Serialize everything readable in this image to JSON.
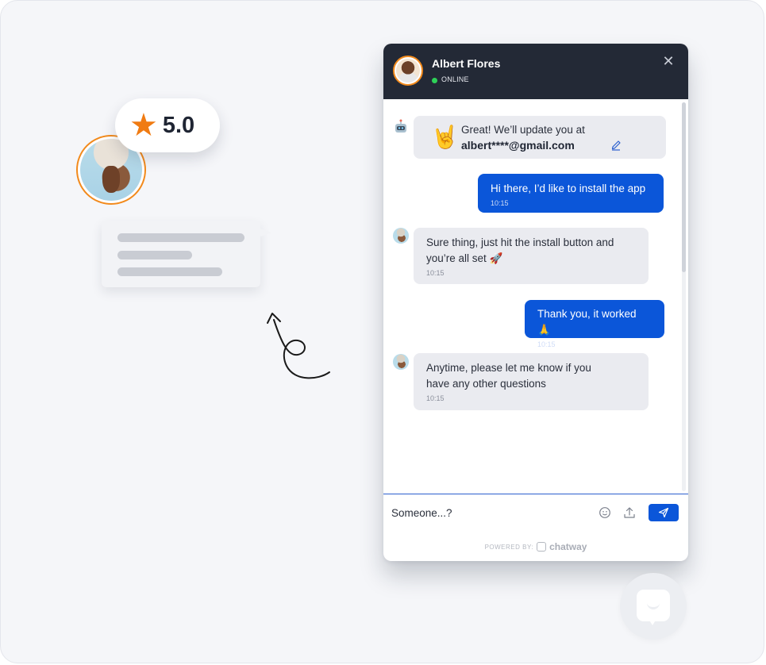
{
  "decoration": {
    "rating": "5.0",
    "star_icon": "star-icon"
  },
  "chat": {
    "header": {
      "agent_name": "Albert Flores",
      "status": "ONLINE",
      "status_color": "#2ed158"
    },
    "messages": {
      "bot_confirm_line1": "Great! We’ll update you at",
      "bot_confirm_email": "albert****@gmail.com",
      "bot_emoji": "🤘",
      "user_1_text": "Hi there, I’d like to install the app",
      "user_1_time": "10:15",
      "agent_1_text": "Sure thing, just hit the install button and\nyou’re all set 🚀",
      "agent_1_time": "10:15",
      "user_2_text": "Thank you, it worked 🙏",
      "user_2_time": "10:15",
      "agent_2_text": "Anytime, please let me know if you\nhave any other questions",
      "agent_2_time": "10:15"
    },
    "composer": {
      "value": "Someone...?",
      "placeholder": "Someone...?"
    },
    "footer": {
      "powered_by": "POWERED BY:",
      "brand": "chatway"
    }
  },
  "colors": {
    "header_bg": "#232936",
    "outgoing_bubble": "#0b56d9",
    "incoming_bubble": "#eaebf0",
    "avatar_ring": "#f28a1c"
  }
}
